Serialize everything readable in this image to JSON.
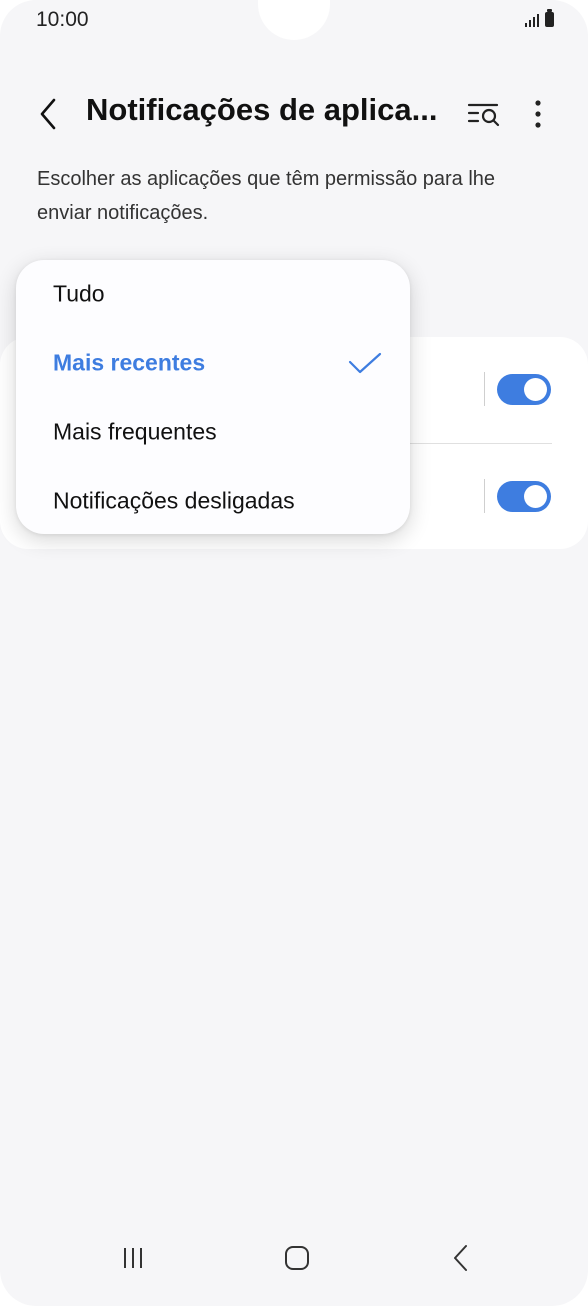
{
  "status_bar": {
    "time": "10:00"
  },
  "header": {
    "title": "Notificações de aplica...",
    "back_icon": "chevron-left-icon",
    "search_icon": "filter-search-icon",
    "more_icon": "more-vertical-icon"
  },
  "description": "Escolher as aplicações que têm permissão para lhe enviar notificações.",
  "app_list": {
    "rows": [
      {
        "toggle_on": true
      },
      {
        "toggle_on": true
      }
    ]
  },
  "sort_menu": {
    "items": [
      {
        "label": "Tudo",
        "selected": false
      },
      {
        "label": "Mais recentes",
        "selected": true
      },
      {
        "label": "Mais frequentes",
        "selected": false
      },
      {
        "label": "Notificações desligadas",
        "selected": false
      }
    ]
  },
  "nav_bar": {
    "recents_icon": "recent-apps-icon",
    "home_icon": "home-icon",
    "back_icon": "back-icon"
  },
  "colors": {
    "accent": "#3e7de0",
    "background": "#f6f6f8",
    "card": "#ffffff"
  }
}
